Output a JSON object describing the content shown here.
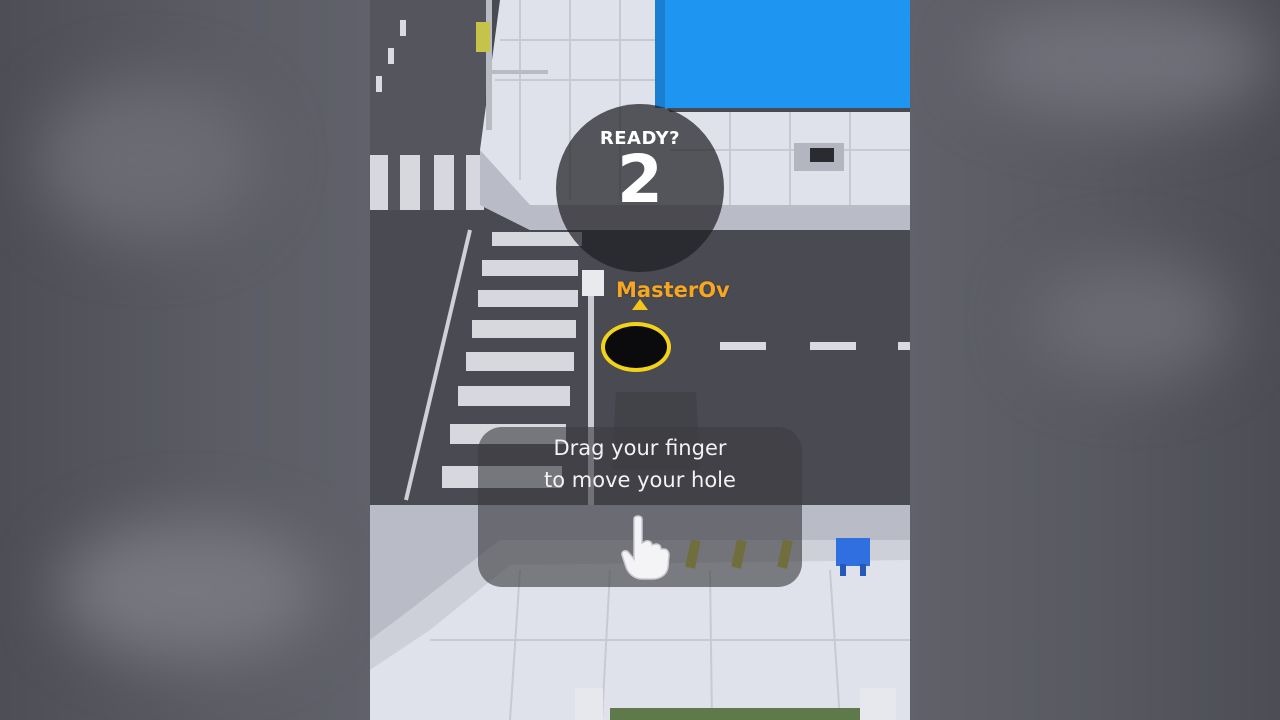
{
  "hud": {
    "ready_label": "READY?",
    "countdown": "2"
  },
  "player": {
    "name": "MasterOv",
    "name_color": "#f5a623",
    "hole_ring_color": "#f3d21a"
  },
  "tutorial": {
    "line1": "Drag your finger",
    "line2": "to move your hole",
    "gesture_icon": "pointing-hand-icon"
  },
  "scene": {
    "water_color": "#1f95f2",
    "road_color": "#4a4b52",
    "sidewalk_color": "#dfe2ea"
  }
}
